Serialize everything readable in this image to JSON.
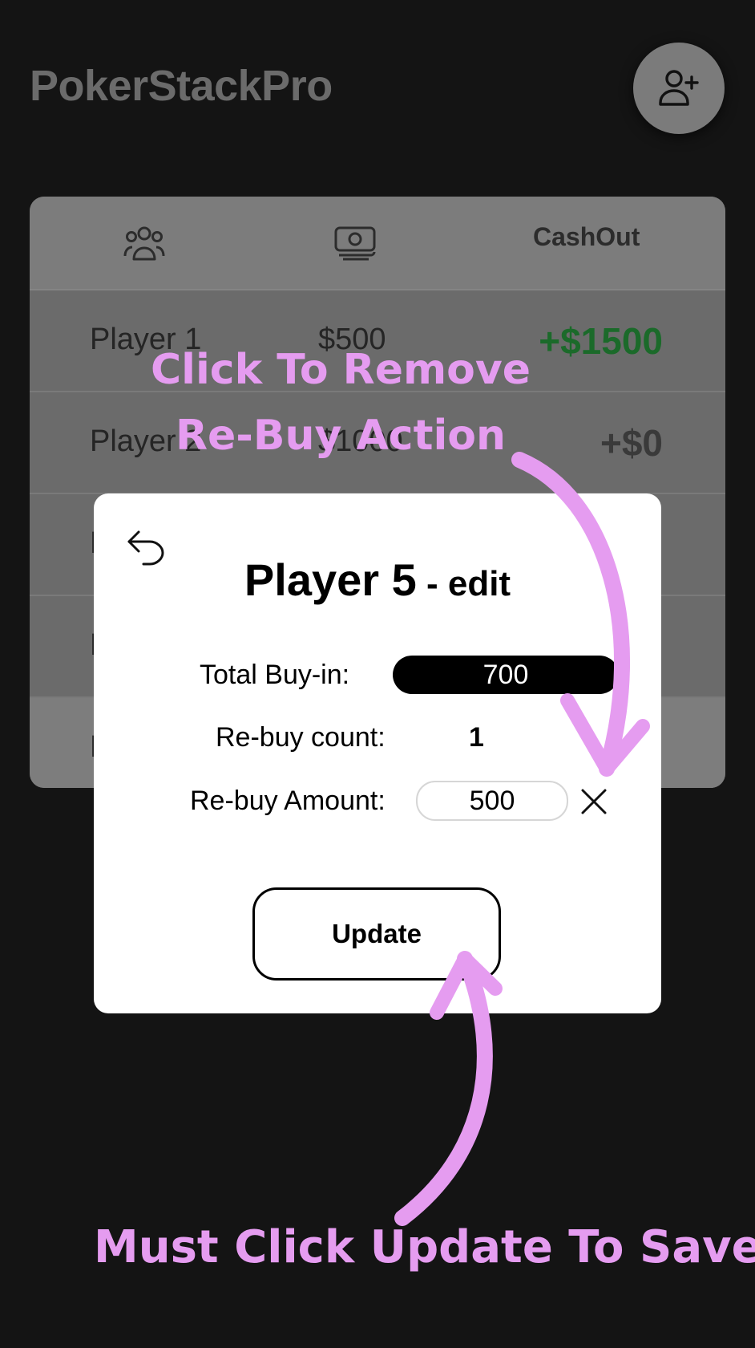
{
  "app": {
    "title": "PokerStackPro"
  },
  "header": {
    "add_player_icon": "person-add-icon"
  },
  "table": {
    "columns": {
      "players_icon": "group-icon",
      "buyin_icon": "cash-icon",
      "cashout_label": "CashOut"
    },
    "rows": [
      {
        "name": "Player 1",
        "buyin": "$500",
        "cashout": "+$1500"
      },
      {
        "name": "Player 2",
        "buyin": "$1000",
        "cashout": "+$0"
      },
      {
        "name": "P",
        "buyin": "",
        "cashout": ""
      },
      {
        "name": "P",
        "buyin": "",
        "cashout": ""
      },
      {
        "name": "P",
        "buyin": "",
        "cashout": ""
      }
    ]
  },
  "modal": {
    "back_icon": "undo-arrow-icon",
    "title_name": "Player 5",
    "title_suffix": " - edit",
    "total_buyin_label": "Total Buy-in:",
    "total_buyin_value": "700",
    "rebuy_count_label": "Re-buy count:",
    "rebuy_count_value": "1",
    "rebuy_amount_label": "Re-buy Amount:",
    "rebuy_amount_value": "500",
    "remove_icon": "close-icon",
    "update_label": "Update"
  },
  "annotations": {
    "remove_line1": "Click To Remove",
    "remove_line2": "Re-Buy Action",
    "save_text": "Must Click Update To Save",
    "color": "#e59cf0"
  },
  "colors": {
    "background": "#141414",
    "win": "#1b6a2a",
    "annotation": "#e59cf0"
  }
}
